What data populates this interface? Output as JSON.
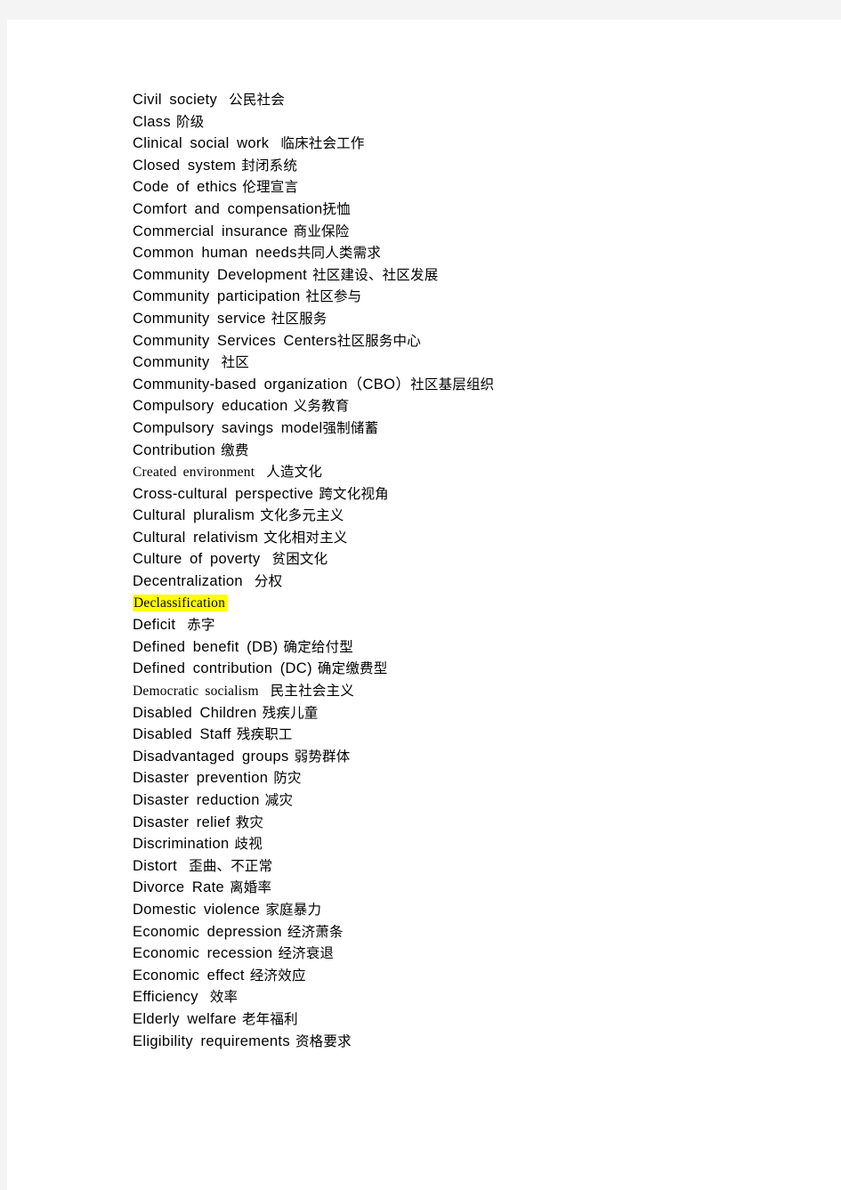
{
  "document": {
    "type": "glossary-list",
    "page_background": "#ffffff",
    "canvas_background": "#f4f4f4",
    "text_color": "#000000",
    "highlight_color": "#ffff00",
    "entries": [
      {
        "term": "Civil society",
        "translation": "公民社会",
        "gap": "lg",
        "style": "sans"
      },
      {
        "term": "Class",
        "translation": "阶级",
        "gap": "md",
        "style": "sans"
      },
      {
        "term": "Clinical social work",
        "translation": "临床社会工作",
        "gap": "lg",
        "style": "sans"
      },
      {
        "term": "Closed system",
        "translation": "封闭系统",
        "gap": "md",
        "style": "sans"
      },
      {
        "term": "Code of ethics",
        "translation": "伦理宣言",
        "gap": "md",
        "style": "sans"
      },
      {
        "term": "Comfort and compensation",
        "translation": "抚恤",
        "gap": "sm",
        "style": "sans"
      },
      {
        "term": "Commercial insurance",
        "translation": "商业保险",
        "gap": "md",
        "style": "sans"
      },
      {
        "term": "Common human needs",
        "translation": "共同人类需求",
        "gap": "sm",
        "style": "sans"
      },
      {
        "term": "Community Development",
        "translation": "社区建设、社区发展",
        "gap": "md",
        "style": "sans"
      },
      {
        "term": "Community participation",
        "translation": "社区参与",
        "gap": "md",
        "style": "sans"
      },
      {
        "term": "Community service",
        "translation": "社区服务",
        "gap": "md",
        "style": "sans"
      },
      {
        "term": "Community Services Centers",
        "translation": "社区服务中心",
        "gap": "sm",
        "style": "sans"
      },
      {
        "term": "Community",
        "translation": "社区",
        "gap": "lg",
        "style": "sans"
      },
      {
        "term": "Community-based organization（CBO）",
        "translation": "社区基层组织",
        "gap": "sm",
        "style": "sans"
      },
      {
        "term": "Compulsory education",
        "translation": "义务教育",
        "gap": "md",
        "style": "sans"
      },
      {
        "term": "Compulsory savings model",
        "translation": "强制储蓄",
        "gap": "sm",
        "style": "sans"
      },
      {
        "term": "Contribution",
        "translation": "缴费",
        "gap": "md",
        "style": "sans"
      },
      {
        "term": "Created environment",
        "translation": "人造文化",
        "gap": "lg",
        "style": "serif"
      },
      {
        "term": "Cross-cultural perspective",
        "translation": "跨文化视角",
        "gap": "md",
        "style": "sans"
      },
      {
        "term": "Cultural pluralism",
        "translation": "文化多元主义",
        "gap": "md",
        "style": "sans"
      },
      {
        "term": "Cultural relativism",
        "translation": "文化相对主义",
        "gap": "md",
        "style": "sans"
      },
      {
        "term": "Culture of poverty",
        "translation": "贫困文化",
        "gap": "lg",
        "style": "sans"
      },
      {
        "term": "Decentralization",
        "translation": "分权",
        "gap": "lg",
        "style": "sans"
      },
      {
        "term": "Declassification",
        "translation": "",
        "gap": "sm",
        "style": "serif",
        "highlight": true
      },
      {
        "term": "Deficit",
        "translation": "赤字",
        "gap": "lg",
        "style": "sans"
      },
      {
        "term": "Defined benefit (DB)",
        "translation": "确定给付型",
        "gap": "md",
        "style": "sans"
      },
      {
        "term": "Defined contribution (DC)",
        "translation": "确定缴费型",
        "gap": "md",
        "style": "sans"
      },
      {
        "term": "Democratic socialism",
        "translation": "民主社会主义",
        "gap": "lg",
        "style": "serif"
      },
      {
        "term": "Disabled Children",
        "translation": "残疾儿童",
        "gap": "md",
        "style": "sans"
      },
      {
        "term": "Disabled Staff",
        "translation": "残疾职工",
        "gap": "md",
        "style": "sans"
      },
      {
        "term": "Disadvantaged groups",
        "translation": "弱势群体",
        "gap": "md",
        "style": "sans"
      },
      {
        "term": "Disaster prevention",
        "translation": "防灾",
        "gap": "md",
        "style": "sans"
      },
      {
        "term": "Disaster reduction",
        "translation": "减灾",
        "gap": "md",
        "style": "sans"
      },
      {
        "term": "Disaster relief",
        "translation": "救灾",
        "gap": "md",
        "style": "sans"
      },
      {
        "term": "Discrimination",
        "translation": "歧视",
        "gap": "md",
        "style": "sans"
      },
      {
        "term": "Distort",
        "translation": "歪曲、不正常",
        "gap": "lg",
        "style": "sans"
      },
      {
        "term": "Divorce Rate",
        "translation": "离婚率",
        "gap": "md",
        "style": "sans"
      },
      {
        "term": "Domestic violence",
        "translation": "家庭暴力",
        "gap": "md",
        "style": "sans"
      },
      {
        "term": "Economic depression",
        "translation": "经济萧条",
        "gap": "md",
        "style": "sans"
      },
      {
        "term": "Economic recession",
        "translation": "经济衰退",
        "gap": "md",
        "style": "sans"
      },
      {
        "term": "Economic effect",
        "translation": "经济效应",
        "gap": "md",
        "style": "sans"
      },
      {
        "term": "Efficiency",
        "translation": "效率",
        "gap": "lg",
        "style": "sans"
      },
      {
        "term": "Elderly welfare",
        "translation": "老年福利",
        "gap": "md",
        "style": "sans"
      },
      {
        "term": "Eligibility requirements",
        "translation": "资格要求",
        "gap": "md",
        "style": "sans"
      }
    ]
  }
}
